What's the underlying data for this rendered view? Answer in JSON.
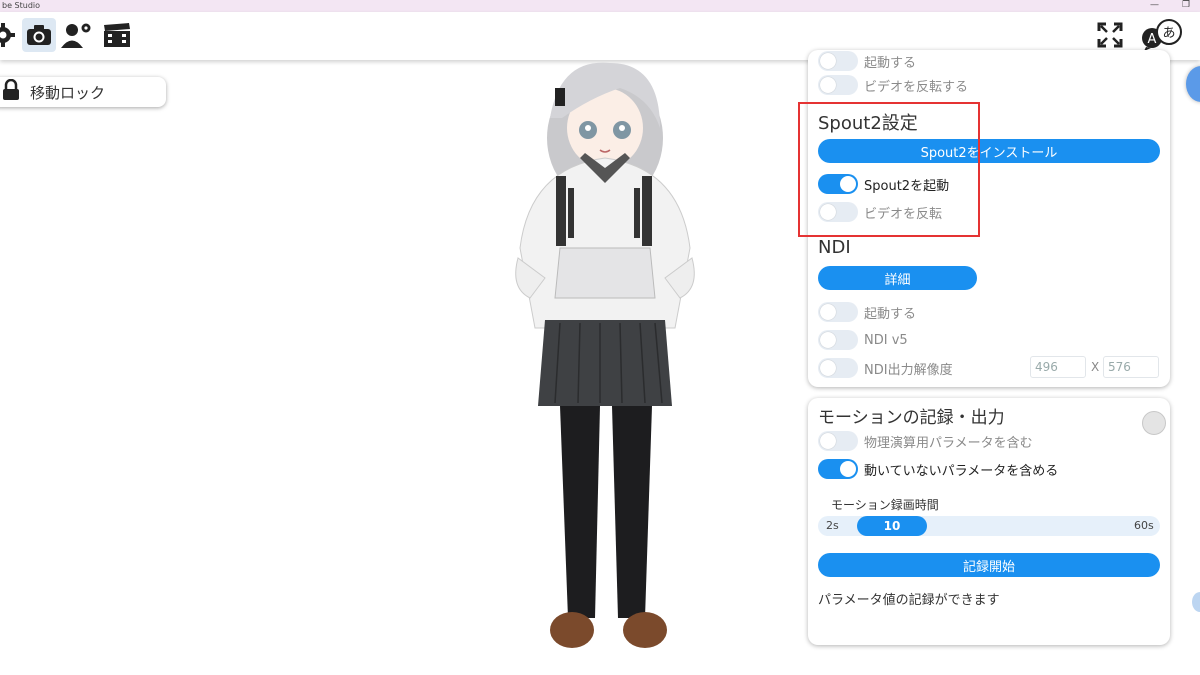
{
  "window": {
    "title": "be Studio",
    "minimize": "—",
    "maximize": "❐"
  },
  "toolbar": {
    "icons": [
      "gear-icon",
      "camera-icon",
      "user-settings-icon",
      "clapperboard-icon",
      "fullscreen-icon",
      "language-icon"
    ],
    "language_glyph_a": "A",
    "language_glyph_b": "あ"
  },
  "lock_chip": {
    "label": "移動ロック"
  },
  "panel1": {
    "top_partial": {
      "label": "起動する"
    },
    "video_flip": {
      "label": "ビデオを反転する",
      "on": false
    },
    "spout": {
      "title": "Spout2設定",
      "install_button": "Spout2をインストール",
      "start": {
        "label": "Spout2を起動",
        "on": true
      },
      "flip": {
        "label": "ビデオを反転",
        "on": false
      }
    },
    "ndi": {
      "title": "NDI",
      "details_button": "詳細",
      "start": {
        "label": "起動する",
        "on": false
      },
      "v5": {
        "label": "NDI v5",
        "on": false
      },
      "resolution": {
        "label": "NDI出力解像度",
        "on": false,
        "width": "496",
        "separator": "X",
        "height": "576"
      }
    }
  },
  "panel2": {
    "title": "モーションの記録・出力",
    "physics": {
      "label": "物理演算用パラメータを含む",
      "on": false
    },
    "static_params": {
      "label": "動いていないパラメータを含める",
      "on": true
    },
    "duration": {
      "label": "モーション録画時間",
      "min": "2s",
      "value": "10",
      "max": "60s",
      "value_fraction": 0.14
    },
    "record_button": "記録開始",
    "status": "パラメータ値の記録ができます"
  },
  "colors": {
    "accent": "#1a90f0",
    "highlight": "#e53333",
    "toggle_off": "#e6ecf3"
  }
}
